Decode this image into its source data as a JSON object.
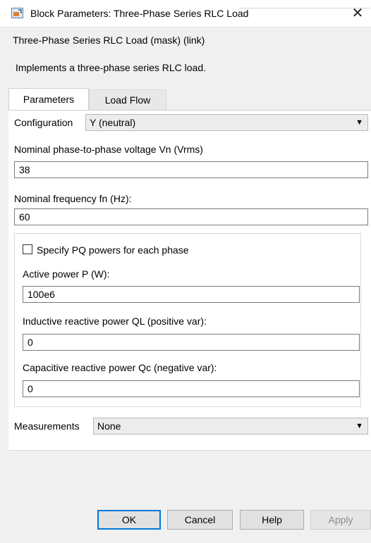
{
  "window": {
    "title": "Block Parameters: Three-Phase Series RLC Load",
    "close_glyph": "✕",
    "app_icon": "simulink-block-icon"
  },
  "mask": {
    "group_title": "Three-Phase Series RLC Load (mask) (link)",
    "description": "Implements a three-phase series RLC load."
  },
  "tabs": [
    {
      "label": "Parameters",
      "active": true
    },
    {
      "label": "Load Flow",
      "active": false
    }
  ],
  "parameters": {
    "configuration": {
      "label": "Configuration",
      "value": "Y (neutral)"
    },
    "voltage": {
      "label": "Nominal phase-to-phase voltage Vn (Vrms)",
      "value": "38"
    },
    "frequency": {
      "label": "Nominal frequency fn (Hz):",
      "value": "60"
    },
    "specify_pq": {
      "label": "Specify PQ powers for each phase",
      "checked": false
    },
    "active_power": {
      "label": "Active power P (W):",
      "value": "100e6"
    },
    "inductive_power": {
      "label": "Inductive reactive power QL (positive var):",
      "value": "0"
    },
    "capacitive_power": {
      "label": "Capacitive reactive power Qc (negative var):",
      "value": "0"
    },
    "measurements": {
      "label": "Measurements",
      "value": "None"
    }
  },
  "buttons": {
    "ok": "OK",
    "cancel": "Cancel",
    "help": "Help",
    "apply": "Apply"
  },
  "colors": {
    "default_button_border": "#0078d7",
    "panel_background": "#ffffff",
    "window_background": "#f0f0f0"
  }
}
